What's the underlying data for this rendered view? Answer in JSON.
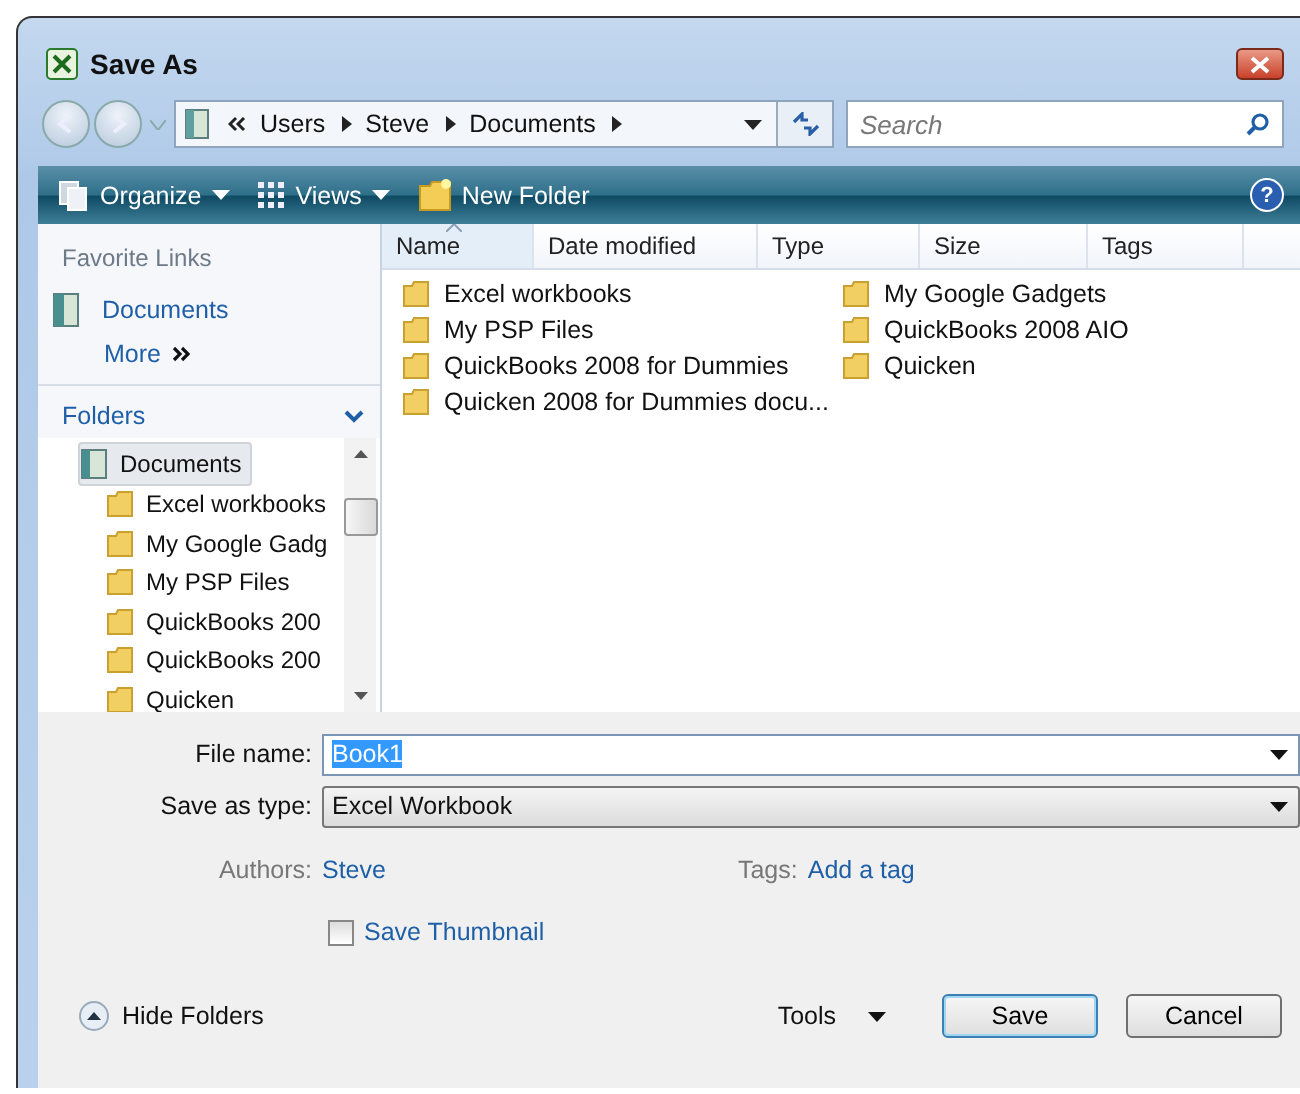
{
  "window": {
    "title": "Save As"
  },
  "address_bar": {
    "path": [
      "Users",
      "Steve",
      "Documents"
    ]
  },
  "search": {
    "placeholder": "Search"
  },
  "toolbar": {
    "items": [
      {
        "label": "Organize",
        "kind": "organize",
        "dropdown": true
      },
      {
        "label": "Views",
        "kind": "views",
        "dropdown": true
      },
      {
        "label": "New Folder",
        "kind": "newfolder",
        "dropdown": false
      }
    ],
    "help": "?"
  },
  "favorite_links": {
    "heading": "Favorite Links",
    "items": [
      {
        "label": "Documents"
      }
    ],
    "more": "More"
  },
  "folders": {
    "heading": "Folders",
    "tree": [
      {
        "label": "Documents",
        "selected": true,
        "children": [
          {
            "label": "Excel workbooks",
            "selected": false
          },
          {
            "label": "My Google Gadg",
            "selected": false
          },
          {
            "label": "My PSP Files",
            "selected": false
          },
          {
            "label": "QuickBooks 200",
            "selected": false
          },
          {
            "label": "QuickBooks 200",
            "selected": false
          },
          {
            "label": "Quicken",
            "selected": false
          }
        ]
      }
    ]
  },
  "file_list": {
    "columns": [
      {
        "label": "Name",
        "sorted": true
      },
      {
        "label": "Date modified",
        "sorted": false
      },
      {
        "label": "Type",
        "sorted": false
      },
      {
        "label": "Size",
        "sorted": false
      },
      {
        "label": "Tags",
        "sorted": false
      }
    ],
    "items": [
      "Excel workbooks",
      "My PSP Files",
      "QuickBooks 2008 for Dummies",
      "Quicken 2008 for Dummies docu...",
      "My Google Gadgets",
      "QuickBooks 2008 AIO",
      "Quicken"
    ]
  },
  "form": {
    "file_name": {
      "label": "File name:",
      "value": "Book1",
      "value_selected": true
    },
    "save_as_type": {
      "label": "Save as type:",
      "value": "Excel Workbook"
    },
    "authors": {
      "label": "Authors:",
      "value": "Steve"
    },
    "tags": {
      "label": "Tags:",
      "value": "Add a tag"
    },
    "save_thumbnail": {
      "label": "Save Thumbnail",
      "checked": false
    }
  },
  "footer": {
    "hide_folders": "Hide Folders",
    "tools": "Tools",
    "buttons": [
      {
        "label": "Save",
        "default": true
      },
      {
        "label": "Cancel",
        "default": false
      }
    ]
  }
}
